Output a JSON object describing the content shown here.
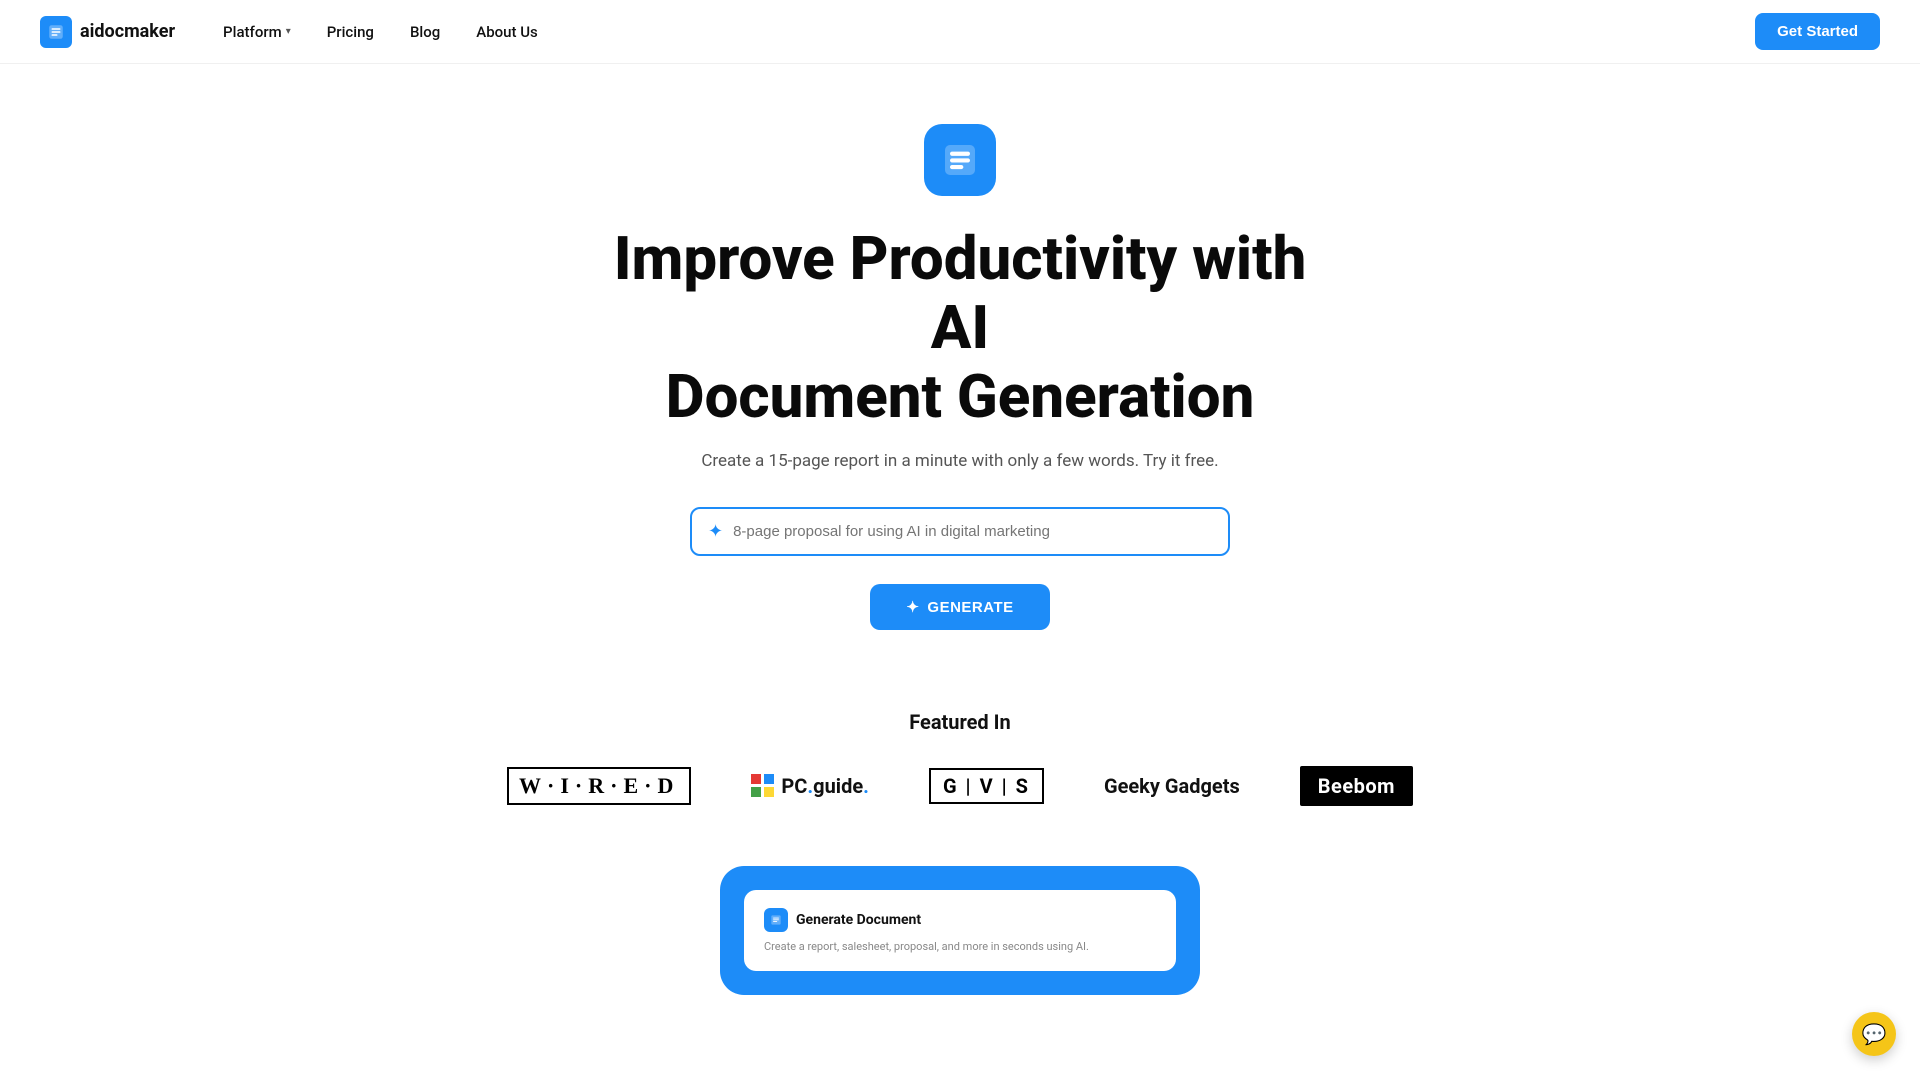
{
  "nav": {
    "logo_text": "aidocmaker",
    "links": [
      {
        "id": "platform",
        "label": "Platform",
        "has_dropdown": true
      },
      {
        "id": "pricing",
        "label": "Pricing",
        "has_dropdown": false
      },
      {
        "id": "blog",
        "label": "Blog",
        "has_dropdown": false
      },
      {
        "id": "about",
        "label": "About Us",
        "has_dropdown": false
      }
    ],
    "cta_label": "Get Started"
  },
  "hero": {
    "heading_line1": "Improve Productivity with AI",
    "heading_line2": "Document Generation",
    "subtext": "Create a 15-page report in a minute with only a few words. Try it free.",
    "input_placeholder": "8-page proposal for using AI in digital marketing",
    "generate_label": "GENERATE"
  },
  "featured": {
    "title": "Featured In",
    "logos": [
      {
        "id": "wired",
        "name": "WIRED"
      },
      {
        "id": "pcguide",
        "name": "PCguide"
      },
      {
        "id": "gvs",
        "name": "GVS"
      },
      {
        "id": "geeky",
        "name": "Geeky Gadgets"
      },
      {
        "id": "beebom",
        "name": "Beebom"
      }
    ]
  },
  "preview": {
    "title": "Generate Document",
    "desc": "Create a report, salesheet, proposal, and more in seconds using AI."
  },
  "chat_widget": {
    "icon": "💬"
  }
}
